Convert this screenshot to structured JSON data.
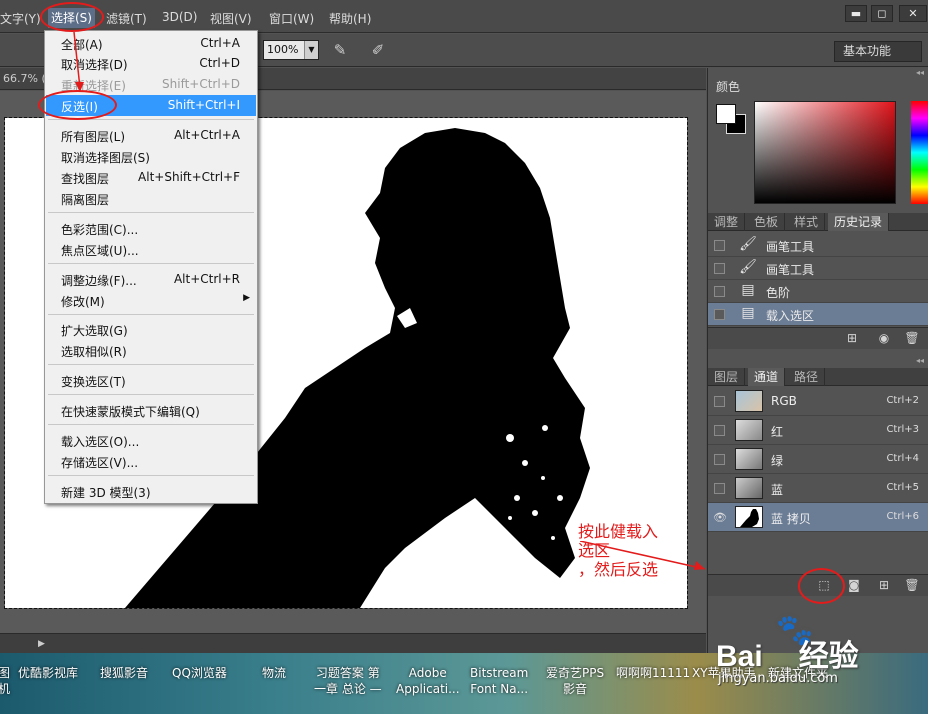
{
  "menubar": {
    "items": [
      "文字(Y)",
      "选择(S)",
      "滤镜(T)",
      "3D(D)",
      "视图(V)",
      "窗口(W)",
      "帮助(H)"
    ],
    "window_buttons": [
      "▬",
      "◻",
      "✕"
    ]
  },
  "options": {
    "zoom": "100%",
    "workspace": "基本功能"
  },
  "document": {
    "tab_label": "66.7% (B"
  },
  "select_menu": {
    "items": [
      {
        "label": "全部(A)",
        "shortcut": "Ctrl+A"
      },
      {
        "label": "取消选择(D)",
        "shortcut": "Ctrl+D"
      },
      {
        "label": "重新选择(E)",
        "shortcut": "Shift+Ctrl+D"
      },
      {
        "label": "反选(I)",
        "shortcut": "Shift+Ctrl+I"
      },
      {
        "label": "所有图层(L)",
        "shortcut": "Alt+Ctrl+A"
      },
      {
        "label": "取消选择图层(S)",
        "shortcut": ""
      },
      {
        "label": "查找图层",
        "shortcut": "Alt+Shift+Ctrl+F"
      },
      {
        "label": "隔离图层",
        "shortcut": ""
      },
      {
        "label": "色彩范围(C)...",
        "shortcut": ""
      },
      {
        "label": "焦点区域(U)...",
        "shortcut": ""
      },
      {
        "label": "调整边缘(F)...",
        "shortcut": "Alt+Ctrl+R"
      },
      {
        "label": "修改(M)",
        "shortcut": ""
      },
      {
        "label": "扩大选取(G)",
        "shortcut": ""
      },
      {
        "label": "选取相似(R)",
        "shortcut": ""
      },
      {
        "label": "变换选区(T)",
        "shortcut": ""
      },
      {
        "label": "在快速蒙版模式下编辑(Q)",
        "shortcut": ""
      },
      {
        "label": "载入选区(O)...",
        "shortcut": ""
      },
      {
        "label": "存储选区(V)...",
        "shortcut": ""
      },
      {
        "label": "新建 3D 模型(3)",
        "shortcut": ""
      }
    ],
    "submenu_arrow": "▶"
  },
  "color_panel": {
    "title": "颜色",
    "foreground": "#ffffff",
    "background": "#000000"
  },
  "history_panel": {
    "tabs": [
      "调整",
      "色板",
      "样式",
      "历史记录"
    ],
    "rows": [
      {
        "icon": "brush-icon",
        "label": "画笔工具"
      },
      {
        "icon": "brush-icon",
        "label": "画笔工具"
      },
      {
        "icon": "document-icon",
        "label": "色阶"
      },
      {
        "icon": "document-icon",
        "label": "载入选区"
      }
    ]
  },
  "channels_panel": {
    "tabs": [
      "图层",
      "通道",
      "路径"
    ],
    "rows": [
      {
        "label": "RGB",
        "shortcut": "Ctrl+2"
      },
      {
        "label": "红",
        "shortcut": "Ctrl+3"
      },
      {
        "label": "绿",
        "shortcut": "Ctrl+4"
      },
      {
        "label": "蓝",
        "shortcut": "Ctrl+5"
      },
      {
        "label": "蓝 拷贝",
        "shortcut": "Ctrl+6"
      }
    ]
  },
  "annotation": {
    "text": "按此健载入\n选区\n，然后反选",
    "color": "#e31b1b"
  },
  "taskbar": {
    "items": [
      "图\n机",
      "优酷影视库",
      "搜狐影音",
      "QQ浏览器",
      "物流",
      "习题答案 第\n一章 总论 —",
      "Adobe\nApplicati...",
      "Bitstream\nFont Na...",
      "爱奇艺PPS\n影音",
      "啊啊啊11111",
      "XY苹果助手",
      "新建文件夹"
    ]
  },
  "watermark": {
    "brand": "Bai",
    "brand2": "经验",
    "sub": "jingyan.baidu.com"
  }
}
